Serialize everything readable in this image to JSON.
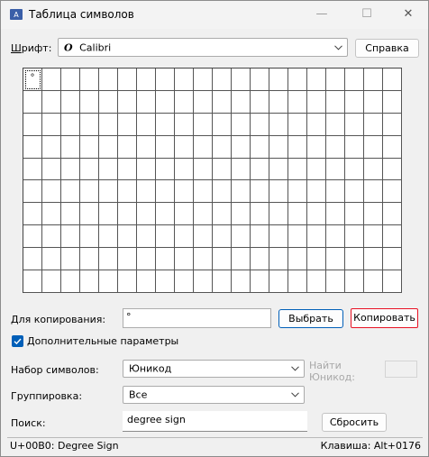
{
  "window": {
    "title": "Таблица символов"
  },
  "font_row": {
    "label": "Шрифт:",
    "font_glyph": "O",
    "selected_font": "Calibri",
    "help_button": "Справка"
  },
  "grid": {
    "rows": 10,
    "cols": 20,
    "selected_char": "°"
  },
  "copy_row": {
    "label": "Для копирования:",
    "value": "°",
    "select_button": "Выбрать",
    "copy_button": "Копировать"
  },
  "advanced": {
    "label": "Дополнительные параметры",
    "checked": true
  },
  "charset": {
    "label": "Набор символов:",
    "value": "Юникод",
    "find_label_1": "Найти",
    "find_label_2": "Юникод:"
  },
  "grouping": {
    "label": "Группировка:",
    "value": "Все"
  },
  "search": {
    "label": "Поиск:",
    "value": "degree sign",
    "reset_button": "Сбросить"
  },
  "status": {
    "code": "U+00B0: Degree Sign",
    "keystroke": "Клавиша: Alt+0176"
  },
  "colors": {
    "accent": "#005fb8",
    "copy_highlight": "#e81123"
  }
}
